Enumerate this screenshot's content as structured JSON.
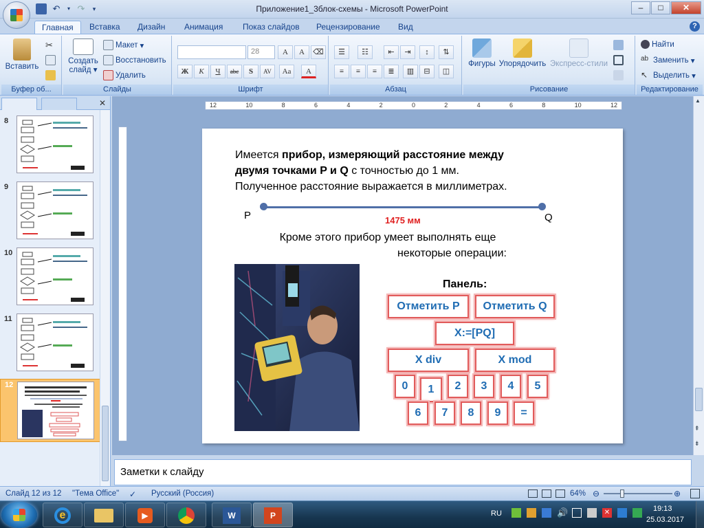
{
  "window": {
    "title": "Приложение1_3блок-схемы - Microsoft PowerPoint"
  },
  "tabs": [
    "Главная",
    "Вставка",
    "Дизайн",
    "Анимация",
    "Показ слайдов",
    "Рецензирование",
    "Вид"
  ],
  "ribbon": {
    "clipboard": {
      "paste": "Вставить",
      "label": "Буфер об..."
    },
    "slides": {
      "new_slide": "Создать слайд",
      "layout": "Макет",
      "reset": "Восстановить",
      "delete": "Удалить",
      "label": "Слайды"
    },
    "font": {
      "size": "28",
      "label": "Шрифт",
      "bold": "Ж",
      "italic": "К",
      "underline": "Ч",
      "strike": "abc",
      "shadow": "S"
    },
    "paragraph": {
      "label": "Абзац"
    },
    "drawing": {
      "shapes": "Фигуры",
      "arrange": "Упорядочить",
      "quick_styles": "Экспресс-стили",
      "label": "Рисование"
    },
    "editing": {
      "find": "Найти",
      "replace": "Заменить",
      "select": "Выделить",
      "label": "Редактирование"
    }
  },
  "thumbnails": [
    {
      "num": "8"
    },
    {
      "num": "9"
    },
    {
      "num": "10"
    },
    {
      "num": "11"
    },
    {
      "num": "12"
    }
  ],
  "ruler": {
    "labels": [
      "12",
      "10",
      "8",
      "6",
      "4",
      "2",
      "0",
      "2",
      "4",
      "6",
      "8",
      "10",
      "12"
    ]
  },
  "slide": {
    "line1_plain": "Имеется ",
    "line1_bold": "прибор, измеряющий расстояние между",
    "line2_bold": "двумя точками P и Q",
    "line2_plain": " с точностью до 1 мм.",
    "line3": "Полученное расстояние выражается в миллиметрах.",
    "p_label": "P",
    "q_label": "Q",
    "distance": "1475 мм",
    "more_line1": "Кроме этого прибор умеет выполнять еще",
    "more_line2": "некоторые операции:",
    "panel_title": "Панель:",
    "buttons": {
      "mark_p": "Отметить P",
      "mark_q": "Отметить Q",
      "assign": "X:=[PQ]",
      "div": "X div",
      "mod": "X mod",
      "d0": "0",
      "d1": "1",
      "d2": "2",
      "d3": "3",
      "d4": "4",
      "d5": "5",
      "d6": "6",
      "d7": "7",
      "d8": "8",
      "d9": "9",
      "eq": "="
    }
  },
  "notes": {
    "placeholder": "Заметки к слайду"
  },
  "status": {
    "slide_info": "Слайд 12 из 12",
    "theme": "\"Тема Office\"",
    "language": "Русский (Россия)",
    "zoom": "64%"
  },
  "tray": {
    "lang": "RU",
    "time": "19:13",
    "date": "25.03.2017"
  },
  "colors": {
    "accent_red": "#e02020",
    "button_text": "#1f6cb3",
    "selected_thumb": "#fbc46d"
  }
}
